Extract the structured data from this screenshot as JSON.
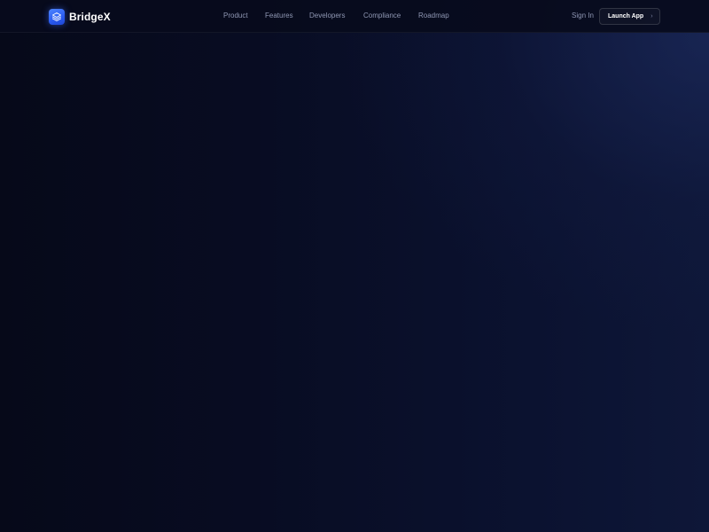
{
  "header": {
    "brand": "BridgeX",
    "nav": [
      {
        "label": "Product"
      },
      {
        "label": "Features"
      },
      {
        "label": "Developers"
      },
      {
        "label": "Compliance"
      },
      {
        "label": "Roadmap"
      }
    ],
    "sign_in": "Sign In",
    "launch_app": "Launch App",
    "launch_icon": "chevron-right-icon"
  },
  "colors": {
    "accent": "#2f6bff",
    "background": "#070b1d",
    "nav_text": "#8f97b3",
    "text_primary": "#ffffff"
  }
}
